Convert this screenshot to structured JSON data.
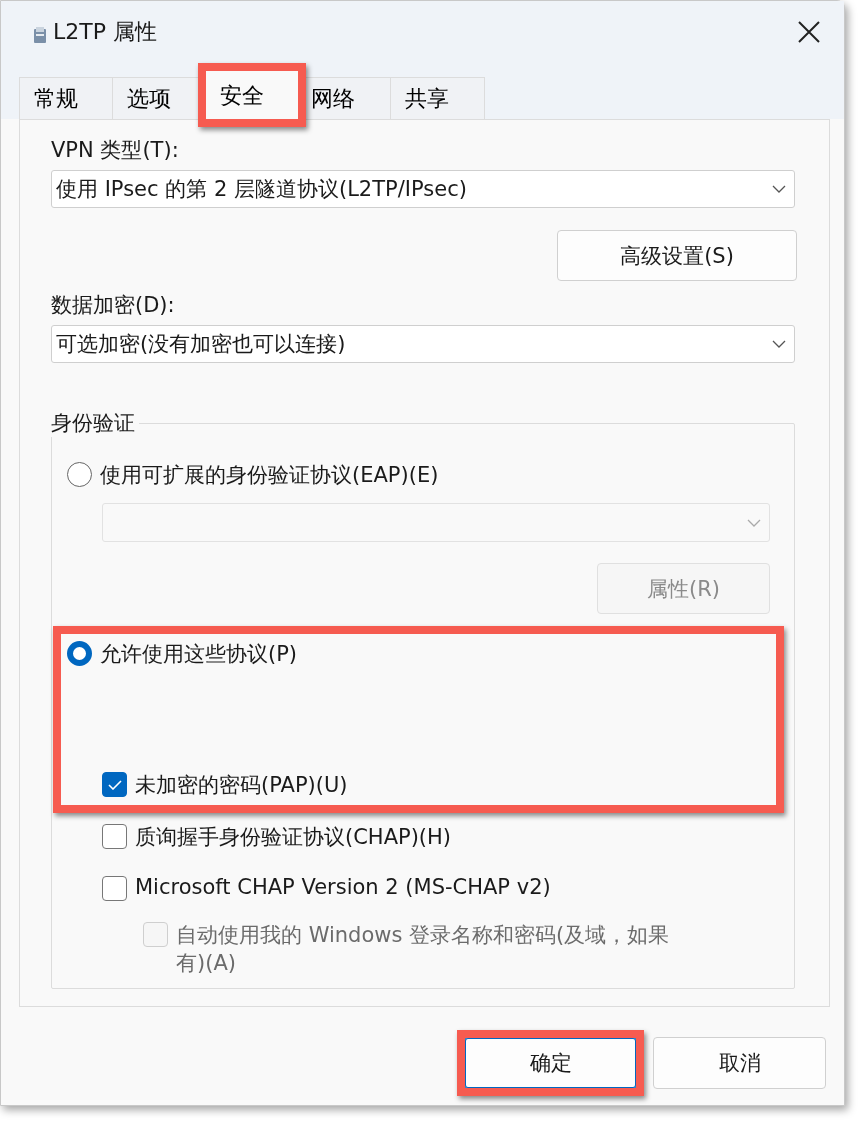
{
  "window": {
    "title": "L2TP 属性"
  },
  "tabs": [
    {
      "label": "常规",
      "selected": false,
      "highlighted": false
    },
    {
      "label": "选项",
      "selected": false,
      "highlighted": false
    },
    {
      "label": "安全",
      "selected": true,
      "highlighted": true
    },
    {
      "label": "网络",
      "selected": false,
      "highlighted": false
    },
    {
      "label": "共享",
      "selected": false,
      "highlighted": false
    }
  ],
  "vpn_type": {
    "label": "VPN 类型(T):",
    "value": "使用 IPsec 的第 2 层隧道协议(L2TP/IPsec)"
  },
  "advanced_button": {
    "label": "高级设置(S)"
  },
  "encryption": {
    "label": "数据加密(D):",
    "value": "可选加密(没有加密也可以连接)"
  },
  "auth": {
    "legend": "身份验证",
    "eap": {
      "label": "使用可扩展的身份验证协议(EAP)(E)",
      "selected": false,
      "dropdown": {
        "disabled": true
      },
      "properties_button": {
        "label": "属性(R)",
        "disabled": true
      }
    },
    "allow": {
      "label": "允许使用这些协议(P)",
      "selected": true,
      "highlighted": true,
      "protocols": [
        {
          "label": "未加密的密码(PAP)(U)",
          "checked": true,
          "disabled": false,
          "highlighted": true
        },
        {
          "label": "质询握手身份验证协议(CHAP)(H)",
          "checked": false,
          "disabled": false,
          "highlighted": false
        },
        {
          "label": "Microsoft CHAP Version 2 (MS-CHAP v2)",
          "checked": false,
          "disabled": false,
          "highlighted": false,
          "children": [
            {
              "label": "自动使用我的 Windows 登录名称和密码(及域，如果有)(A)",
              "checked": false,
              "disabled": true
            }
          ]
        }
      ]
    }
  },
  "buttons": [
    {
      "label": "确定",
      "default": true,
      "highlighted": true
    },
    {
      "label": "取消",
      "default": false,
      "highlighted": false
    }
  ]
}
